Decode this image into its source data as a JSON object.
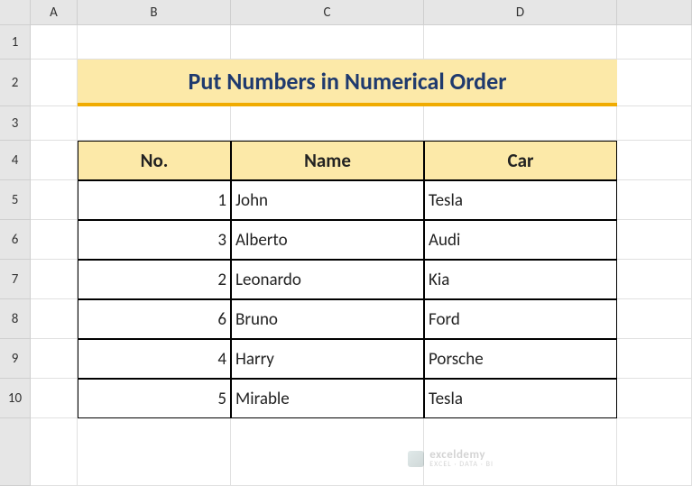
{
  "columns": [
    "A",
    "B",
    "C",
    "D"
  ],
  "rows": [
    "1",
    "2",
    "3",
    "4",
    "5",
    "6",
    "7",
    "8",
    "9",
    "10"
  ],
  "title": "Put Numbers in Numerical Order",
  "table": {
    "headers": [
      "No.",
      "Name",
      "Car"
    ],
    "data": [
      {
        "no": "1",
        "name": "John",
        "car": "Tesla"
      },
      {
        "no": "3",
        "name": "Alberto",
        "car": "Audi"
      },
      {
        "no": "2",
        "name": "Leonardo",
        "car": "Kia"
      },
      {
        "no": "6",
        "name": "Bruno",
        "car": "Ford"
      },
      {
        "no": "4",
        "name": "Harry",
        "car": "Porsche"
      },
      {
        "no": "5",
        "name": "Mirable",
        "car": "Tesla"
      }
    ]
  },
  "watermark": {
    "main": "exceldemy",
    "sub": "EXCEL · DATA · BI"
  },
  "chart_data": {
    "type": "table",
    "title": "Put Numbers in Numerical Order",
    "columns": [
      "No.",
      "Name",
      "Car"
    ],
    "rows": [
      [
        1,
        "John",
        "Tesla"
      ],
      [
        3,
        "Alberto",
        "Audi"
      ],
      [
        2,
        "Leonardo",
        "Kia"
      ],
      [
        6,
        "Bruno",
        "Ford"
      ],
      [
        4,
        "Harry",
        "Porsche"
      ],
      [
        5,
        "Mirable",
        "Tesla"
      ]
    ]
  }
}
